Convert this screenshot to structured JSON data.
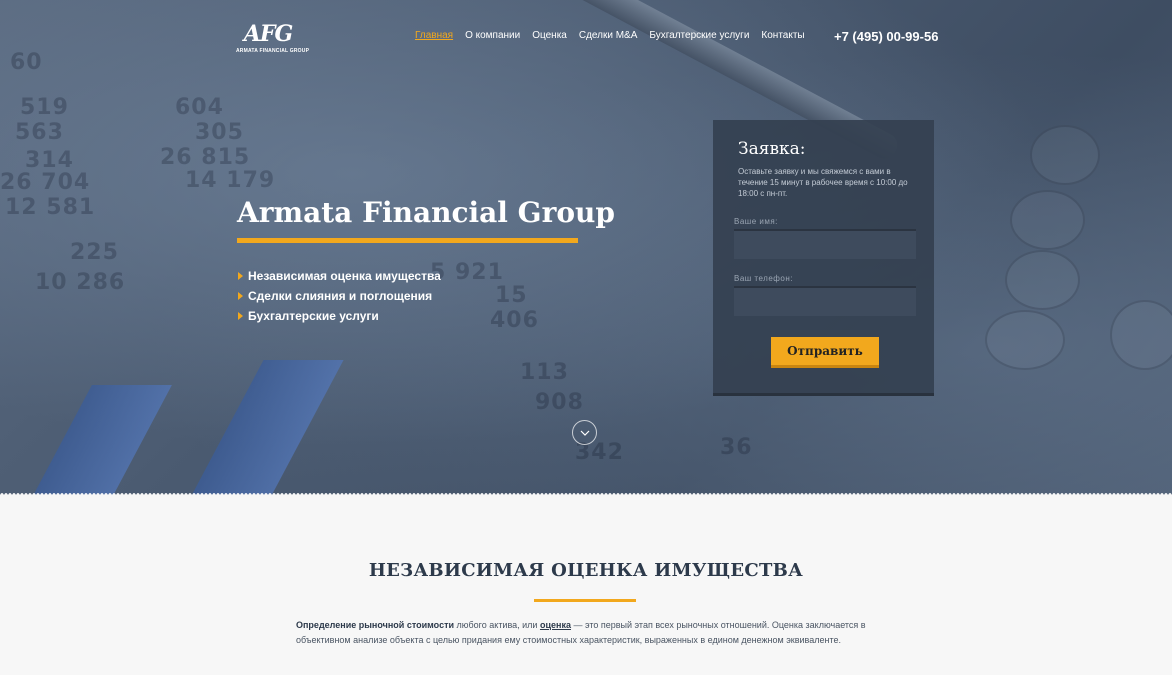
{
  "logo": {
    "mark": "AFG",
    "subtitle": "ARMATA FINANCIAL GROUP"
  },
  "nav": {
    "items": [
      {
        "label": "Главная",
        "active": true
      },
      {
        "label": "О компании",
        "active": false
      },
      {
        "label": "Оценка",
        "active": false
      },
      {
        "label": "Сделки M&A",
        "active": false
      },
      {
        "label": "Бухгалтерские услуги",
        "active": false
      },
      {
        "label": "Контакты",
        "active": false
      }
    ]
  },
  "phone": "+7 (495) 00-99-56",
  "hero": {
    "title": "Armata Financial Group",
    "services": [
      "Независимая оценка имущества",
      "Сделки слияния и поглощения",
      "Бухгалтерские услуги"
    ]
  },
  "form": {
    "title": "Заявка:",
    "description": "Оставьте заявку и мы свяжемся с вами в течение 15 минут в рабочее время с 10:00 до 18:00 с пн-пт.",
    "name_label": "Ваше имя:",
    "name_value": "",
    "phone_label": "Ваш телефон:",
    "phone_value": "",
    "submit_label": "Отправить"
  },
  "section": {
    "title": "НЕЗАВИСИМАЯ ОЦЕНКА ИМУЩЕСТВА",
    "text_bold": "Определение рыночной стоимости",
    "text_part1": " любого актива, или ",
    "text_link": "оценка",
    "text_part2": " — это первый этап всех рыночных отношений. Оценка заключается в объективном анализе объекта с целью придания ему стоимостных характеристик, выраженных в едином денежном эквиваленте."
  },
  "colors": {
    "accent": "#f2a81d",
    "form_bg": "#344050",
    "heading": "#2d3a4b"
  },
  "icons": {
    "scroll": "chevron-down-icon",
    "bullet": "triangle-right-icon"
  }
}
